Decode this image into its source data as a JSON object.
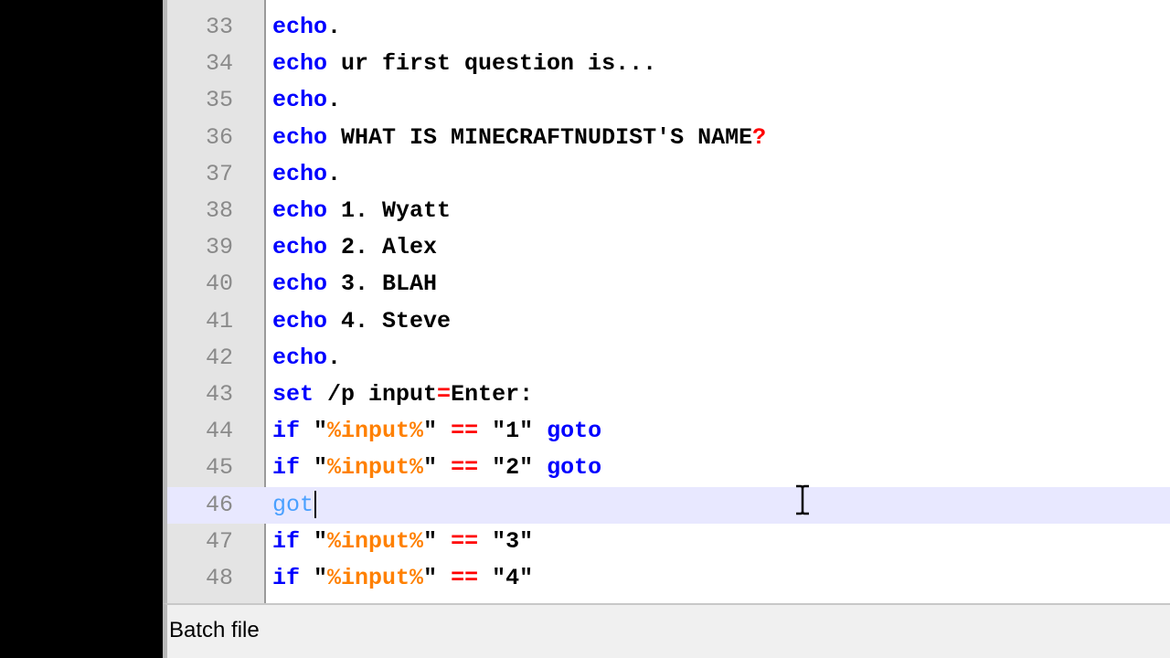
{
  "editor": {
    "lines": [
      {
        "num": "33",
        "tokens": [
          {
            "t": "echo",
            "c": "kw"
          },
          {
            "t": ".",
            "c": "txt"
          }
        ]
      },
      {
        "num": "34",
        "tokens": [
          {
            "t": "echo",
            "c": "kw"
          },
          {
            "t": " ur first question is...",
            "c": "txt"
          }
        ]
      },
      {
        "num": "35",
        "tokens": [
          {
            "t": "echo",
            "c": "kw"
          },
          {
            "t": ".",
            "c": "txt"
          }
        ]
      },
      {
        "num": "36",
        "tokens": [
          {
            "t": "echo",
            "c": "kw"
          },
          {
            "t": " WHAT IS MINECRAFTNUDIST'S NAME",
            "c": "txt"
          },
          {
            "t": "?",
            "c": "op"
          }
        ]
      },
      {
        "num": "37",
        "tokens": [
          {
            "t": "echo",
            "c": "kw"
          },
          {
            "t": ".",
            "c": "txt"
          }
        ]
      },
      {
        "num": "38",
        "tokens": [
          {
            "t": "echo",
            "c": "kw"
          },
          {
            "t": " 1. Wyatt",
            "c": "txt"
          }
        ]
      },
      {
        "num": "39",
        "tokens": [
          {
            "t": "echo",
            "c": "kw"
          },
          {
            "t": " 2. Alex",
            "c": "txt"
          }
        ]
      },
      {
        "num": "40",
        "tokens": [
          {
            "t": "echo",
            "c": "kw"
          },
          {
            "t": " 3. BLAH",
            "c": "txt"
          }
        ]
      },
      {
        "num": "41",
        "tokens": [
          {
            "t": "echo",
            "c": "kw"
          },
          {
            "t": " 4. Steve",
            "c": "txt"
          }
        ]
      },
      {
        "num": "42",
        "tokens": [
          {
            "t": "echo",
            "c": "kw"
          },
          {
            "t": ".",
            "c": "txt"
          }
        ]
      },
      {
        "num": "43",
        "tokens": [
          {
            "t": "set",
            "c": "kw"
          },
          {
            "t": " /p input",
            "c": "txt"
          },
          {
            "t": "=",
            "c": "op"
          },
          {
            "t": "Enter:",
            "c": "txt"
          }
        ]
      },
      {
        "num": "44",
        "tokens": [
          {
            "t": "if",
            "c": "kw"
          },
          {
            "t": " \"",
            "c": "txt"
          },
          {
            "t": "%input%",
            "c": "var"
          },
          {
            "t": "\" ",
            "c": "txt"
          },
          {
            "t": "==",
            "c": "op"
          },
          {
            "t": " \"1\" ",
            "c": "txt"
          },
          {
            "t": "goto",
            "c": "kw"
          }
        ]
      },
      {
        "num": "45",
        "tokens": [
          {
            "t": "if",
            "c": "kw"
          },
          {
            "t": " \"",
            "c": "txt"
          },
          {
            "t": "%input%",
            "c": "var"
          },
          {
            "t": "\" ",
            "c": "txt"
          },
          {
            "t": "==",
            "c": "op"
          },
          {
            "t": " \"2\" ",
            "c": "txt"
          },
          {
            "t": "goto",
            "c": "kw"
          }
        ]
      },
      {
        "num": "46",
        "current": true,
        "tokens": [
          {
            "t": "got",
            "c": "partial"
          }
        ]
      },
      {
        "num": "47",
        "tokens": [
          {
            "t": "if",
            "c": "kw"
          },
          {
            "t": " \"",
            "c": "txt"
          },
          {
            "t": "%input%",
            "c": "var"
          },
          {
            "t": "\" ",
            "c": "txt"
          },
          {
            "t": "==",
            "c": "op"
          },
          {
            "t": " \"3\"",
            "c": "txt"
          }
        ]
      },
      {
        "num": "48",
        "tokens": [
          {
            "t": "if",
            "c": "kw"
          },
          {
            "t": " \"",
            "c": "txt"
          },
          {
            "t": "%input%",
            "c": "var"
          },
          {
            "t": "\" ",
            "c": "txt"
          },
          {
            "t": "==",
            "c": "op"
          },
          {
            "t": " \"4\"",
            "c": "txt"
          }
        ]
      }
    ]
  },
  "colors": {
    "keyword": "#0000ff",
    "operator": "#ff0000",
    "variable": "#ff8000",
    "current_line": "#e8e8ff"
  },
  "statusbar": {
    "language": "Batch file"
  },
  "cursor": {
    "icon": "text-ibeam-cursor-icon"
  }
}
